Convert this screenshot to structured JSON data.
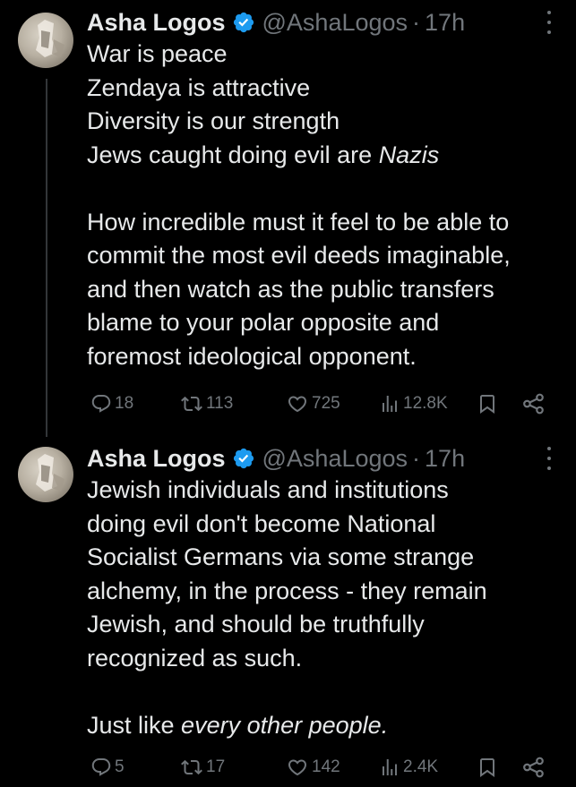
{
  "tweets": [
    {
      "name": "Asha Logos",
      "handle": "@AshaLogos",
      "separator": "·",
      "time": "17h",
      "lines": [
        {
          "text": "War is peace"
        },
        {
          "text": "Zendaya is attractive"
        },
        {
          "text": "Diversity is our strength"
        },
        {
          "text": "Jews caught doing evil are ",
          "em": "Nazis"
        },
        {
          "text": ""
        },
        {
          "text": "How incredible must it feel to be able to"
        },
        {
          "text": "commit the most evil deeds imaginable,"
        },
        {
          "text": "and then watch as the public transfers"
        },
        {
          "text": "blame to your polar opposite and"
        },
        {
          "text": "foremost ideological opponent."
        }
      ],
      "stats": {
        "replies": "18",
        "reposts": "113",
        "likes": "725",
        "views": "12.8K"
      }
    },
    {
      "name": "Asha Logos",
      "handle": "@AshaLogos",
      "separator": "·",
      "time": "17h",
      "lines": [
        {
          "text": "Jewish individuals and institutions"
        },
        {
          "text": "doing evil don't become National"
        },
        {
          "text": "Socialist Germans via some strange"
        },
        {
          "text": "alchemy, in the process - they remain"
        },
        {
          "text": "Jewish, and should be truthfully"
        },
        {
          "text": "recognized as such."
        },
        {
          "text": ""
        },
        {
          "text": "Just like ",
          "em": "every other people."
        }
      ],
      "stats": {
        "replies": "5",
        "reposts": "17",
        "likes": "142",
        "views": "2.4K"
      }
    }
  ],
  "colors": {
    "background": "#000000",
    "text": "#e7e9ea",
    "muted": "#71767b",
    "verified": "#1d9bf0",
    "thread_line": "#333639"
  },
  "icons": [
    "verified-badge-icon",
    "more-icon",
    "reply-icon",
    "repost-icon",
    "like-icon",
    "views-icon",
    "bookmark-icon",
    "share-icon"
  ]
}
